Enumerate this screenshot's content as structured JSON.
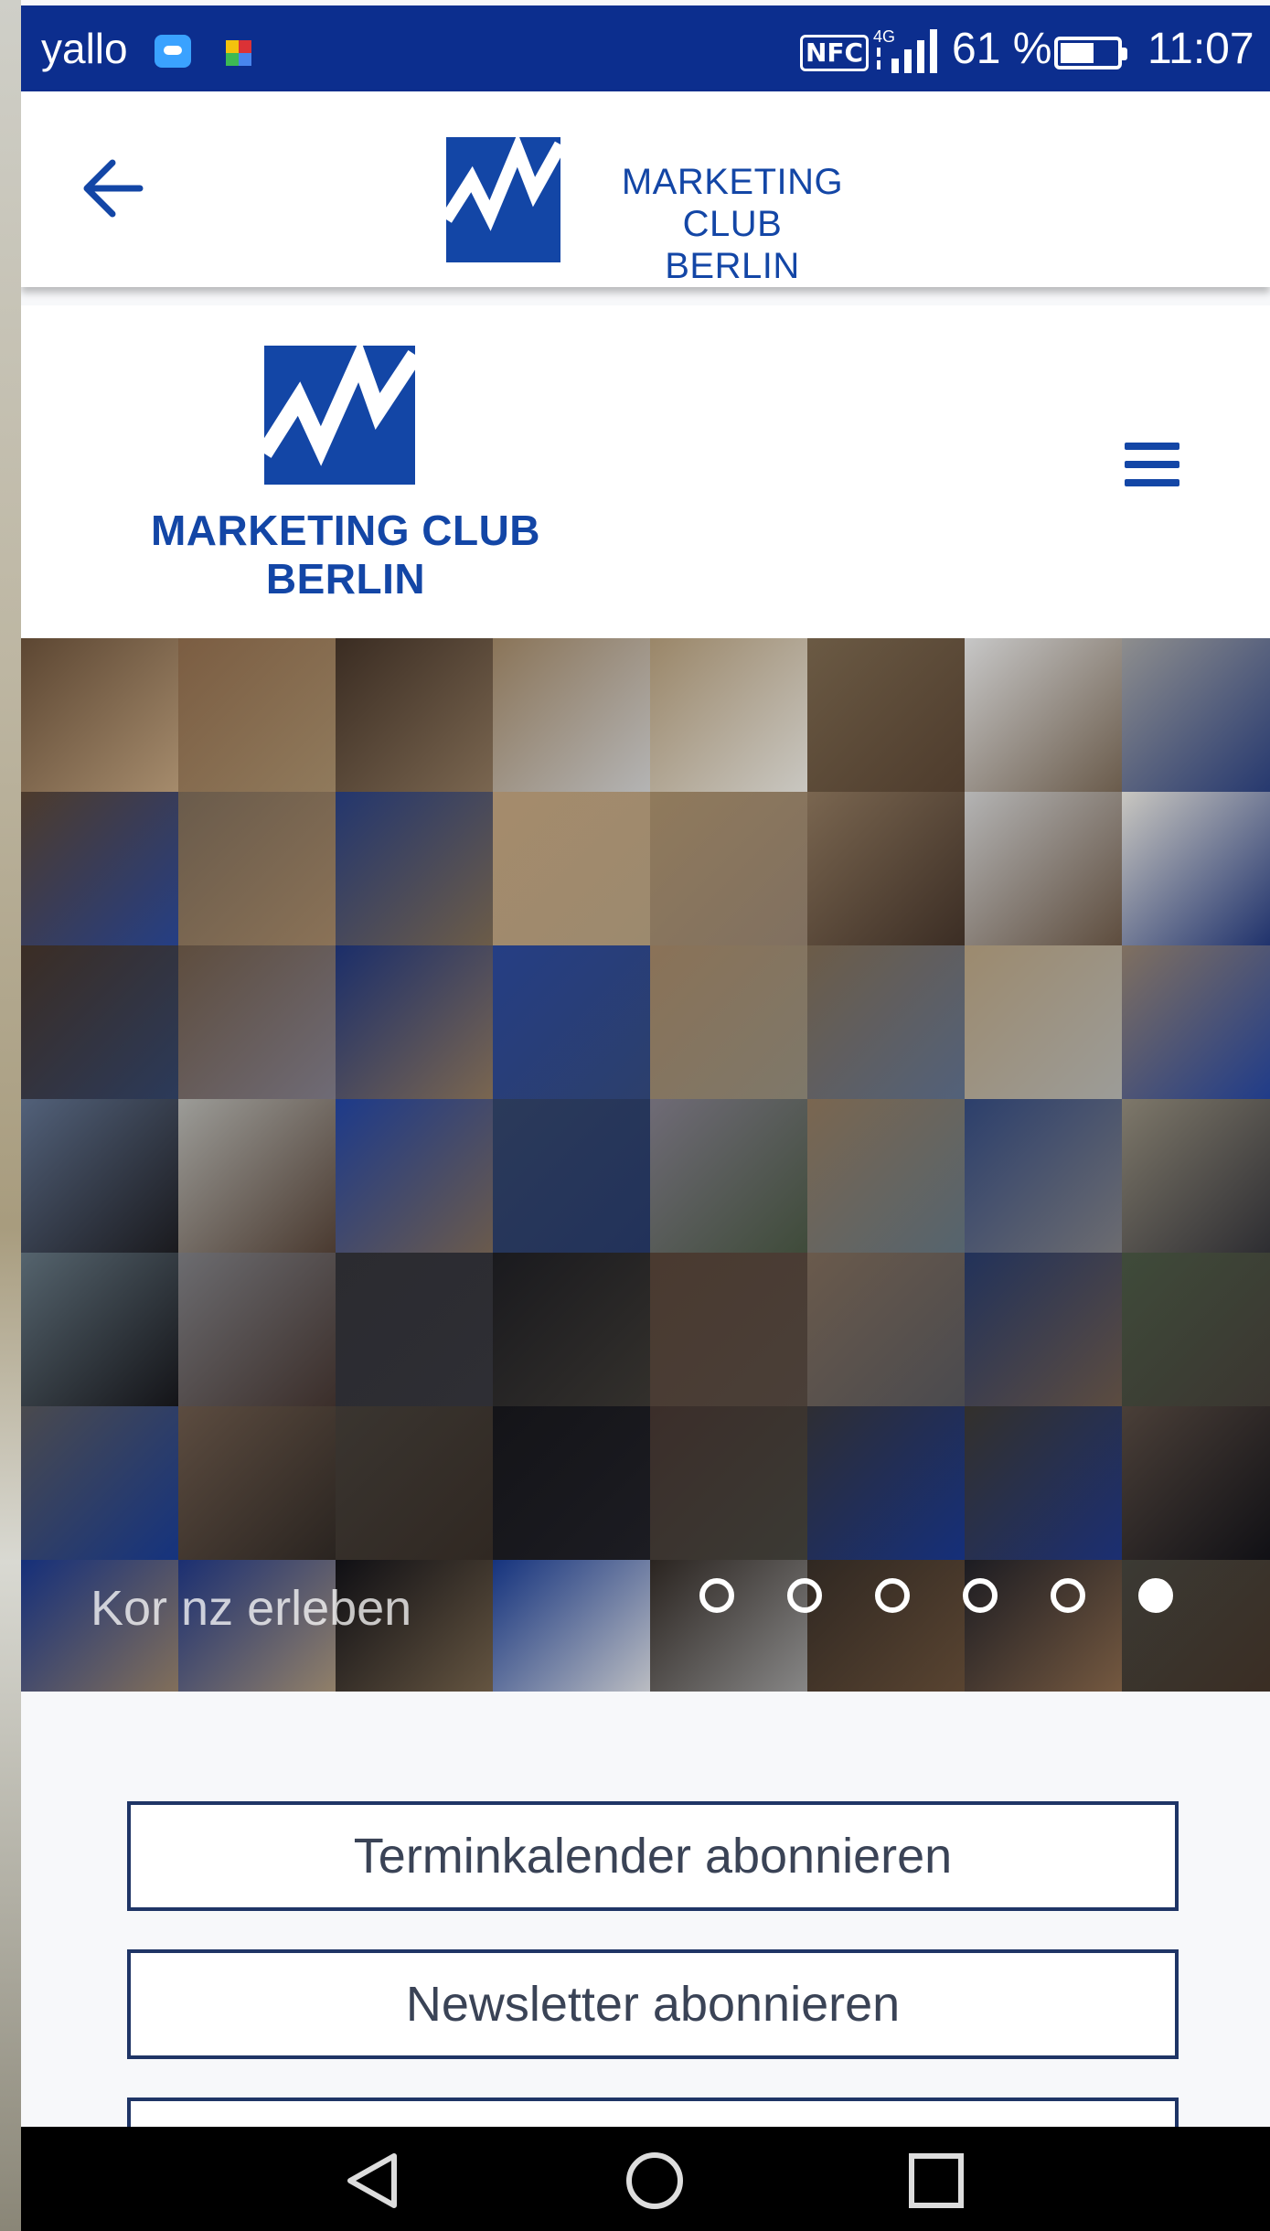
{
  "status_bar": {
    "carrier": "yallo",
    "nfc_label": "NFC",
    "network": "4G",
    "battery_percent": "61 %",
    "time": "11:07",
    "icons": [
      "message-icon",
      "puzzle-icon",
      "nfc-icon",
      "signal-icon",
      "battery-icon"
    ]
  },
  "app_bar": {
    "back_icon": "arrow-left-icon",
    "logo_line1": "MARKETING CLUB",
    "logo_line2": "BERLIN"
  },
  "site_header": {
    "logo_line1": "MARKETING CLUB",
    "logo_line2": "BERLIN",
    "menu_icon": "hamburger-icon"
  },
  "slider": {
    "caption": "Kor      nz erleben",
    "slide_count": 6,
    "active_slide": 6
  },
  "buttons": {
    "terminkalender": "Terminkalender abonnieren",
    "newsletter": "Newsletter abonnieren",
    "third": ""
  },
  "nav_bar": {
    "icons": [
      "back-triangle-icon",
      "home-circle-icon",
      "recents-square-icon"
    ]
  },
  "colors": {
    "brand_blue": "#1346a6",
    "status_bar": "#0c2e8e",
    "button_border": "#1f3566"
  }
}
